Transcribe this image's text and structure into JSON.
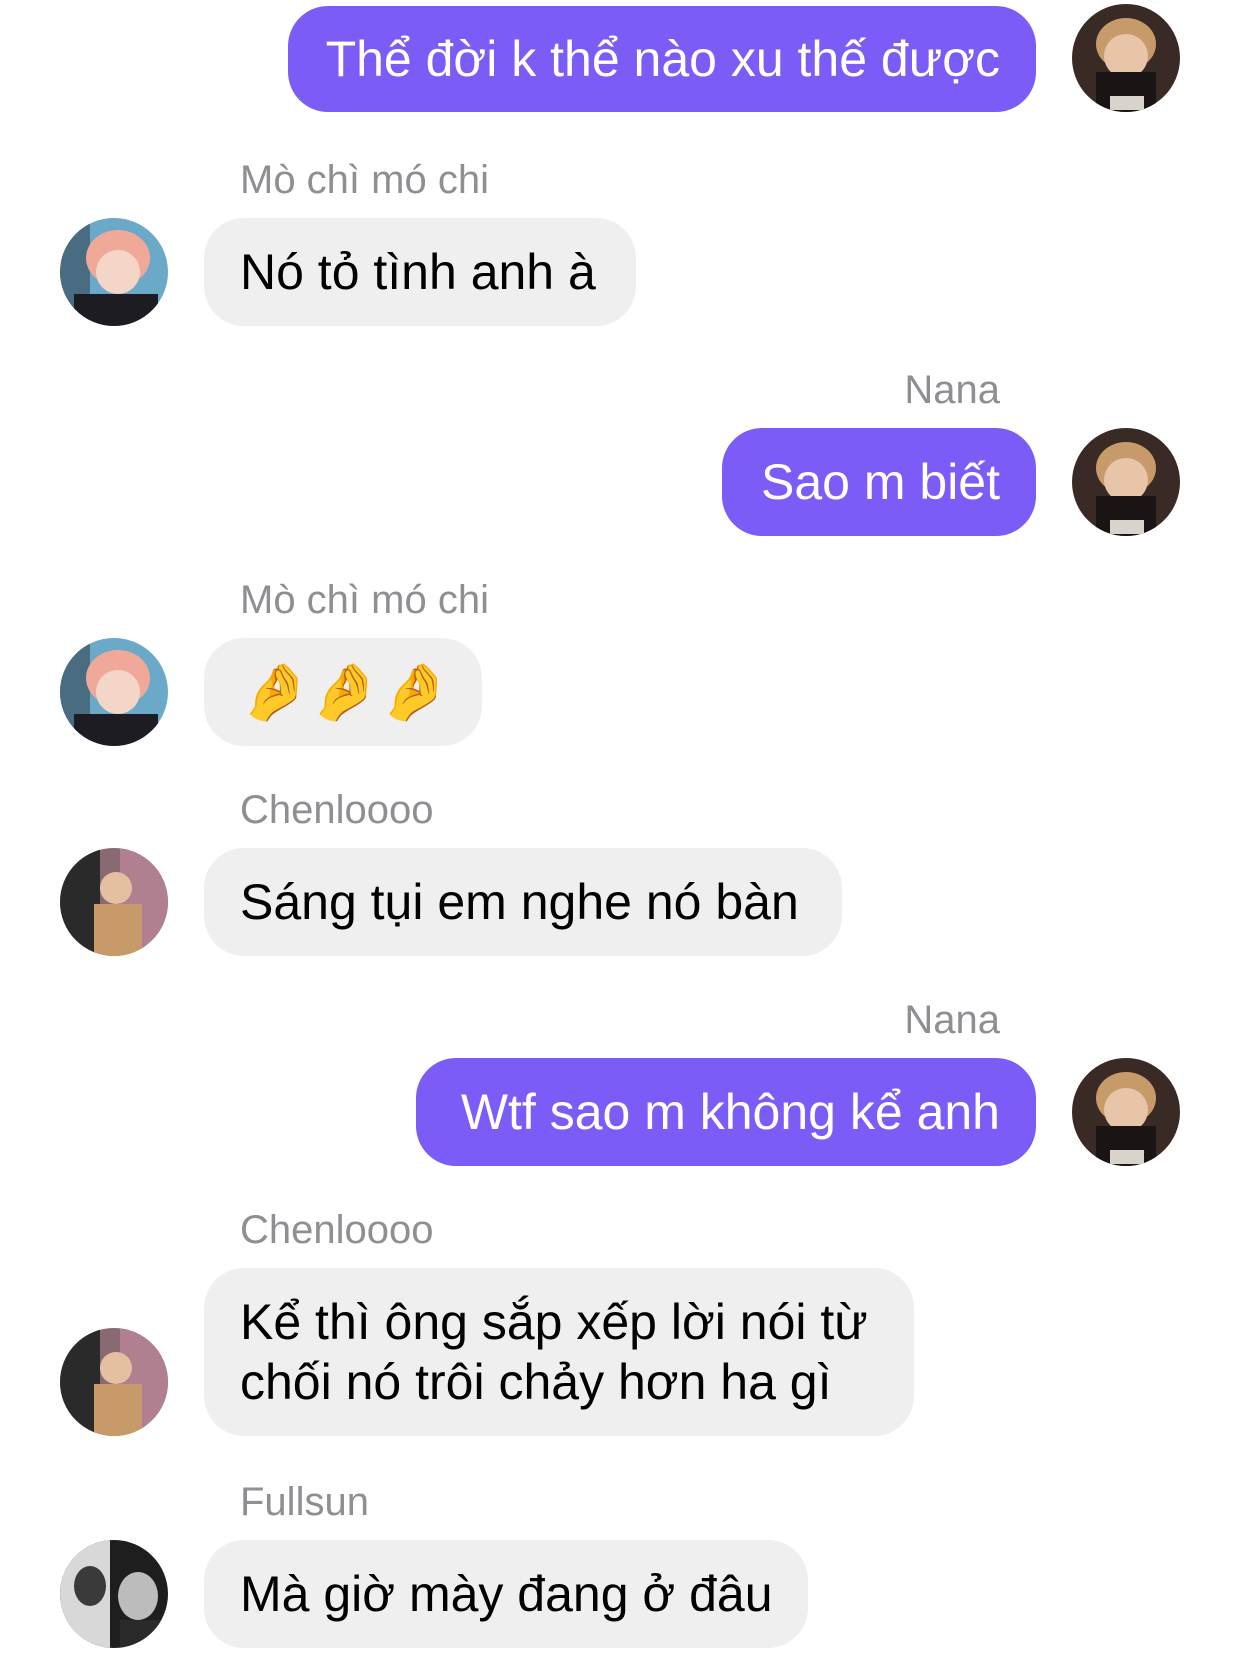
{
  "messages": [
    {
      "id": 1,
      "direction": "outgoing",
      "sender": "",
      "text": "Thể đời k thể nào xu thế được",
      "avatar": "avatar-nana"
    },
    {
      "id": 2,
      "direction": "incoming",
      "sender": "Mò chì mó chi",
      "text": "Nó tỏ tình anh à",
      "avatar": "avatar-pink-hair"
    },
    {
      "id": 3,
      "direction": "outgoing",
      "sender": "Nana",
      "text": "Sao m biết",
      "avatar": "avatar-nana"
    },
    {
      "id": 4,
      "direction": "incoming",
      "sender": "Mò chì mó chi",
      "text": "🤌🤌🤌",
      "avatar": "avatar-pink-hair"
    },
    {
      "id": 5,
      "direction": "incoming",
      "sender": "Chenloooo",
      "text": "Sáng tụi em nghe nó bàn",
      "avatar": "avatar-chenle"
    },
    {
      "id": 6,
      "direction": "outgoing",
      "sender": "Nana",
      "text": "Wtf sao m không kể anh",
      "avatar": "avatar-nana"
    },
    {
      "id": 7,
      "direction": "incoming",
      "sender": "Chenloooo",
      "text_lines": [
        "Kể thì ông sắp xếp lời nói từ",
        "chối nó trôi chảy hơn ha gì"
      ],
      "avatar": "avatar-chenle"
    },
    {
      "id": 8,
      "direction": "incoming",
      "sender": "Fullsun",
      "text": "Mà giờ mày đang ở đâu",
      "avatar": "avatar-fullsun"
    }
  ],
  "colors": {
    "outgoing_bubble": "#7b5cf6",
    "incoming_bubble": "#efeff0",
    "sender_name": "#8e8e93"
  }
}
